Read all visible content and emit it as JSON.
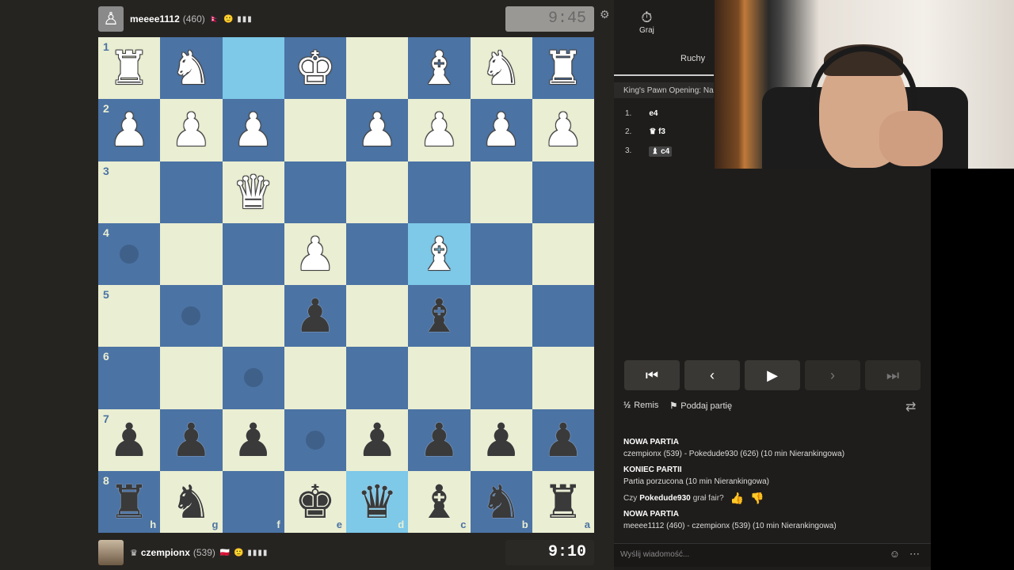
{
  "top_player": {
    "name": "meeee1112",
    "rating": "(460)",
    "flags": "🇳🇵 🙂 ▮▮▮",
    "clock": "9:45"
  },
  "bottom_player": {
    "name": "czempionx",
    "rating": "(539)",
    "flags": "🇵🇱 🙂 ▮▮▮▮",
    "clock": "9:10"
  },
  "board": {
    "ranks": [
      "1",
      "2",
      "3",
      "4",
      "5",
      "6",
      "7",
      "8"
    ],
    "files": [
      "h",
      "g",
      "f",
      "e",
      "d",
      "c",
      "b",
      "a"
    ],
    "rows": [
      [
        "wR",
        "wN",
        "",
        "wK",
        "",
        "wB",
        "wN",
        "wR"
      ],
      [
        "wP",
        "wP",
        "wP",
        "",
        "wP",
        "wP",
        "wP",
        "wP"
      ],
      [
        "",
        "",
        "wQ",
        "",
        "",
        "",
        "",
        ""
      ],
      [
        "",
        "",
        "",
        "wP",
        "",
        "wB",
        "",
        ""
      ],
      [
        "",
        "",
        "",
        "bP",
        "",
        "bB",
        "",
        ""
      ],
      [
        "",
        "",
        "",
        "",
        "",
        "",
        "",
        ""
      ],
      [
        "bP",
        "bP",
        "bP",
        "",
        "bP",
        "bP",
        "bP",
        "bP"
      ],
      [
        "bR",
        "bN",
        "",
        "bK",
        "bQ",
        "bB",
        "bN",
        "bR"
      ]
    ],
    "highlights": [
      [
        0,
        2
      ],
      [
        3,
        5
      ],
      [
        7,
        4
      ]
    ],
    "dots": [
      [
        3,
        0
      ],
      [
        4,
        1
      ],
      [
        5,
        2
      ],
      [
        6,
        3
      ]
    ]
  },
  "panel": {
    "play_tab": "Graj",
    "moves_tab": "Ruchy",
    "opening": "King's Pawn Opening: Na",
    "moves": [
      {
        "num": "1.",
        "move": "e4",
        "icon": ""
      },
      {
        "num": "2.",
        "move": "f3",
        "icon": "♛"
      },
      {
        "num": "3.",
        "move": "c4",
        "icon": "♝"
      }
    ],
    "draw_label": "Remis",
    "draw_icon": "½",
    "resign_label": "Poddaj partię",
    "chat": {
      "new_game_1": "NOWA PARTIA",
      "game_1": "czempionx (539) - Pokedude930 (626) (10 min Nierankingowa)",
      "end_game": "KONIEC PARTII",
      "abandoned": "Partia porzucona (10 min Nierankingowa)",
      "fair_q_prefix": "Czy",
      "fair_q_name": "Pokedude930",
      "fair_q_suffix": "grał fair?",
      "new_game_2": "NOWA PARTIA",
      "game_2": "meeee1112 (460) - czempionx (539) (10 min Nierankingowa)"
    },
    "message_placeholder": "Wyślij wiadomość..."
  }
}
